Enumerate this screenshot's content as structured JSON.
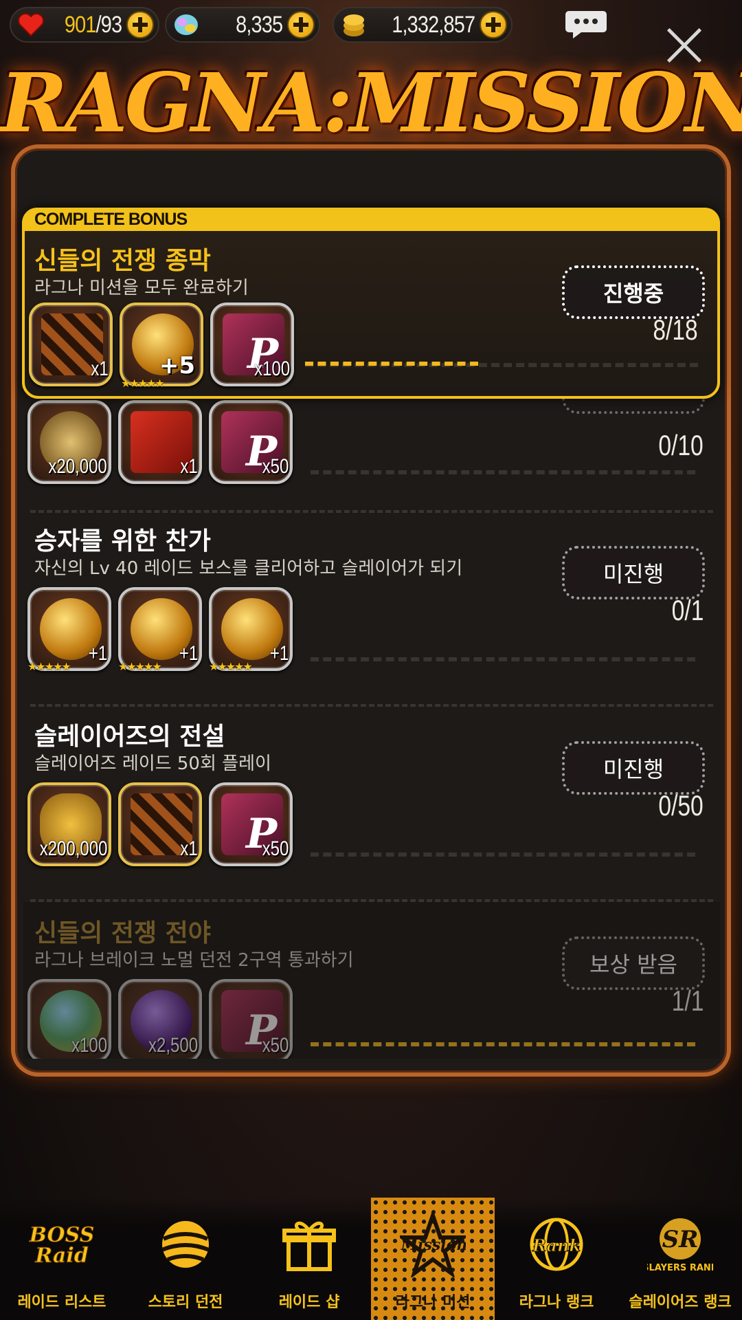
{
  "resources": {
    "hearts": {
      "current": "901",
      "max": "/93"
    },
    "gems": "8,335",
    "gold": "1,332,857"
  },
  "title": "RAGNA:MISSION",
  "bonus_header": "COMPLETE BONUS",
  "missions": [
    {
      "title": "신들의 전쟁 종막",
      "desc": "라그나 미션을 모두 완료하기",
      "status": "진행중",
      "count": "8/18",
      "progress": 0.44,
      "rewards": [
        {
          "icon": "chest-icon",
          "qty": "x1"
        },
        {
          "icon": "weapon-orb-icon",
          "qty": "+5",
          "stars": "★★★★★"
        },
        {
          "icon": "ticket-icon",
          "qty": "x100"
        }
      ]
    },
    {
      "title": "",
      "desc": "",
      "status": "",
      "count": "0/10",
      "progress": 0,
      "rewards": [
        {
          "icon": "badge-icon",
          "qty": "x20,000"
        },
        {
          "icon": "red-card-icon",
          "qty": "x1"
        },
        {
          "icon": "ticket-icon",
          "qty": "x50"
        }
      ]
    },
    {
      "title": "승자를 위한 찬가",
      "desc": "자신의 Lv 40 레이드 보스를 클리어하고 슬레이어가 되기",
      "status": "미진행",
      "count": "0/1",
      "progress": 0,
      "rewards": [
        {
          "icon": "weapon-orb-icon",
          "qty": "+1",
          "stars": "★★★★★"
        },
        {
          "icon": "ring-orb-icon",
          "qty": "+1",
          "stars": "★★★★★"
        },
        {
          "icon": "amulet-orb-icon",
          "qty": "+1",
          "stars": "★★★★★"
        }
      ]
    },
    {
      "title": "슬레이어즈의 전설",
      "desc": "슬레이어즈 레이드 50회 플레이",
      "status": "미진행",
      "count": "0/50",
      "progress": 0,
      "rewards": [
        {
          "icon": "gold-coins-icon",
          "qty": "x200,000"
        },
        {
          "icon": "chest-icon",
          "qty": "x1"
        },
        {
          "icon": "ticket-icon",
          "qty": "x50"
        }
      ]
    },
    {
      "title": "신들의 전쟁 전야",
      "desc": "라그나 브레이크 노멀 던전 2구역 통과하기",
      "status": "보상 받음",
      "count": "1/1",
      "progress": 1,
      "rewards": [
        {
          "icon": "gem-icon",
          "qty": "x100"
        },
        {
          "icon": "purple-gem-icon",
          "qty": "x2,500"
        },
        {
          "icon": "ticket-icon",
          "qty": "x50"
        }
      ]
    }
  ],
  "nav": [
    {
      "label": "레이드 리스트",
      "icon": "boss-raid-icon",
      "badge": "BOSS Raid"
    },
    {
      "label": "스토리 던전",
      "icon": "story-orb-icon",
      "badge": ""
    },
    {
      "label": "레이드 샵",
      "icon": "gift-icon",
      "badge": ""
    },
    {
      "label": "라그나 미션",
      "icon": "mission-star-icon",
      "badge": "Mission"
    },
    {
      "label": "라그나 랭크",
      "icon": "globe-rank-icon",
      "badge": "Rank"
    },
    {
      "label": "슬레이어즈 랭크",
      "icon": "slayers-rank-icon",
      "badge": "SLAYERS RANK"
    }
  ],
  "colors": {
    "accent": "#f3c21a",
    "panel_border": "#b8642a",
    "progress": "#f5b81c"
  }
}
